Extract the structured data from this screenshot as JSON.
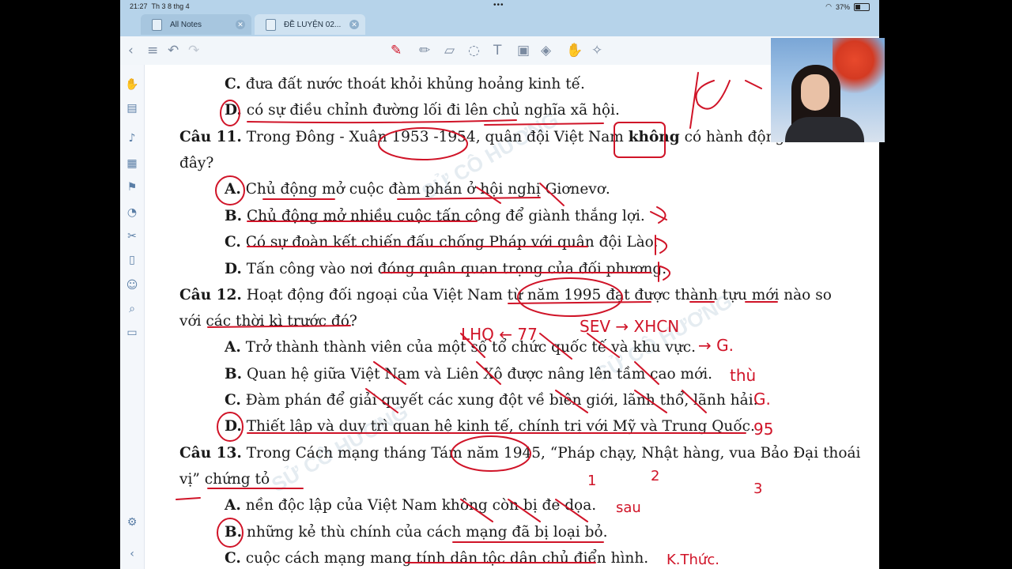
{
  "status": {
    "time": "21:27",
    "date": "Th 3 8 thg 4",
    "battery": "37%"
  },
  "tabs": [
    {
      "label": "All Notes"
    },
    {
      "label": "ĐỀ LUYỆN 02..."
    }
  ],
  "watermark": {
    "text": "SỬ CÔ HƯƠNG"
  },
  "questions": {
    "q10_c": {
      "letter": "C.",
      "text": "đưa đất nước thoát khỏi khủng hoảng kinh tế."
    },
    "q10_d": {
      "letter": "D.",
      "text": "có sự điều chỉnh đường lối đi lên chủ nghĩa xã hội."
    },
    "q11": {
      "label": "Câu 11.",
      "text1": "Trong Đông - Xuân 1953 -1954, quân đội Việt Nam",
      "bold": "không",
      "text2": "có hành động nào sau",
      "text3": "đây?"
    },
    "q11_a": {
      "letter": "A.",
      "text": "Chủ động mở cuộc đàm phán ở hội nghị Giơnevơ."
    },
    "q11_b": {
      "letter": "B.",
      "text": "Chủ động mở nhiều cuộc tấn công để giành thắng lợi."
    },
    "q11_c": {
      "letter": "C.",
      "text": "Có sự đoàn kết chiến đấu chống Pháp với quân đội Lào."
    },
    "q11_d": {
      "letter": "D.",
      "text": "Tấn công vào nơi đóng quân quan trọng của đối phương."
    },
    "q12": {
      "label": "Câu 12.",
      "text1": "Hoạt động đối ngoại của Việt Nam từ năm 1995 đạt được thành tựu mới nào so",
      "text2": "với các thời kì trước đó?"
    },
    "q12_a": {
      "letter": "A.",
      "text": "Trở thành thành viên của một số tổ chức quốc tế và khu vực."
    },
    "q12_b": {
      "letter": "B.",
      "text": "Quan hệ giữa Việt Nam và Liên Xô được nâng lên tầm cao mới."
    },
    "q12_c": {
      "letter": "C.",
      "text": "Đàm phán để giải quyết các xung đột về biên giới, lãnh thổ, lãnh hải."
    },
    "q12_d": {
      "letter": "D.",
      "text": "Thiết lập và duy trì quan hệ kinh tế, chính trị với Mỹ và Trung Quốc."
    },
    "q13": {
      "label": "Câu 13.",
      "text1": "Trong Cách mạng tháng Tám năm 1945, “Pháp chạy, Nhật hàng, vua Bảo Đại thoái",
      "text2": "vị” chứng tỏ"
    },
    "q13_a": {
      "letter": "A.",
      "text": "nền độc lập của Việt Nam không còn bị đe dọa."
    },
    "q13_b": {
      "letter": "B.",
      "text": "những kẻ thù chính của cách mạng đã bị loại bỏ."
    },
    "q13_c": {
      "letter": "C.",
      "text": "cuộc cách mạng mang tính dân tộc dân chủ điển hình."
    }
  },
  "colors": {
    "ink": "#d01428",
    "tabbar": "#b6d3ea",
    "accent": "#5a7ea6"
  }
}
